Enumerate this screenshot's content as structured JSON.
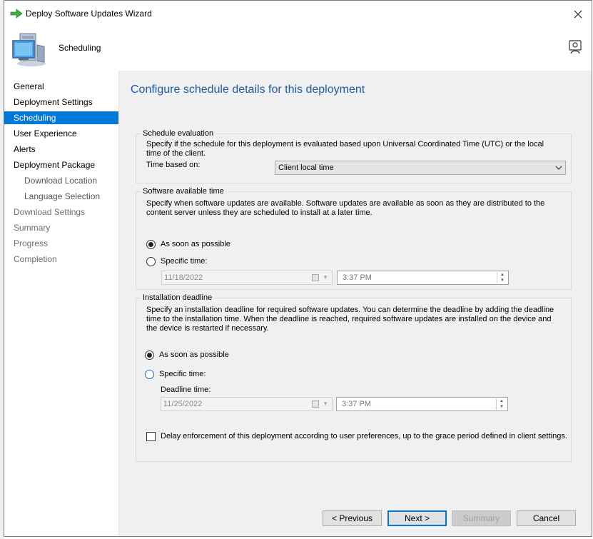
{
  "window": {
    "title": "Deploy Software Updates Wizard",
    "header_title": "Scheduling"
  },
  "sidebar": {
    "items": [
      {
        "label": "General"
      },
      {
        "label": "Deployment Settings"
      },
      {
        "label": "Scheduling"
      },
      {
        "label": "User Experience"
      },
      {
        "label": "Alerts"
      },
      {
        "label": "Deployment Package"
      },
      {
        "label": "Download Location"
      },
      {
        "label": "Language Selection"
      },
      {
        "label": "Download Settings"
      },
      {
        "label": "Summary"
      },
      {
        "label": "Progress"
      },
      {
        "label": "Completion"
      }
    ]
  },
  "content": {
    "heading": "Configure schedule details for this deployment",
    "schedule_evaluation": {
      "title": "Schedule evaluation",
      "description": "Specify if the schedule for this deployment is evaluated based upon Universal Coordinated Time (UTC) or the local time of the client.",
      "time_based_label": "Time based on:",
      "time_based_value": "Client local time"
    },
    "software_available": {
      "title": "Software available time",
      "description": "Specify when software updates are available. Software updates are available as soon as they are distributed to the content server unless they are scheduled to install at a later time.",
      "asap_label": "As soon as possible",
      "specific_label": "Specific time:",
      "date_value": "11/18/2022",
      "time_value": "3:37 PM"
    },
    "installation_deadline": {
      "title": "Installation deadline",
      "description": "Specify an installation deadline for required software updates. You can determine the deadline by adding the deadline time to the installation time. When the deadline is reached, required software updates are installed on the device and the device is restarted if necessary.",
      "asap_label": "As soon as possible",
      "specific_label": "Specific time:",
      "deadline_label": "Deadline time:",
      "date_value": "11/25/2022",
      "time_value": "3:37 PM",
      "delay_label": "Delay enforcement of this deployment according to user preferences, up to the grace period defined in client settings."
    }
  },
  "buttons": {
    "previous": "< Previous",
    "next": "Next >",
    "summary": "Summary",
    "cancel": "Cancel"
  },
  "colors": {
    "accent": "#0078d7",
    "heading": "#1e5aa8"
  }
}
